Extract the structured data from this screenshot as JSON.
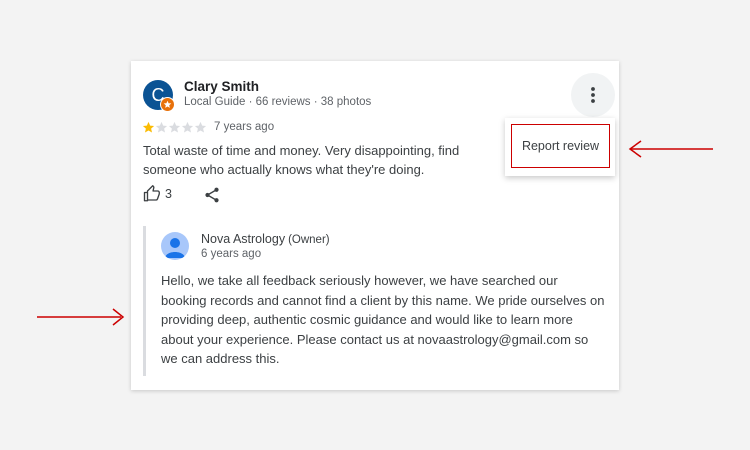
{
  "review": {
    "avatar_initial": "C",
    "author": "Clary Smith",
    "author_meta": "Local Guide · 66 reviews · 38 photos",
    "rating": 1,
    "rating_max": 5,
    "age": "7 years ago",
    "text": "Total waste of time and money. Very disappointing, find someone who actually knows what they're doing.",
    "like_count": "3"
  },
  "owner_reply": {
    "name": "Nova Astrology",
    "tag": "(Owner)",
    "age": "6 years ago",
    "text": "Hello, we take all feedback seriously however, we have searched our booking records and cannot find a client by this name. We pride ourselves on providing deep, authentic cosmic guidance and would like to learn more about your experience. Please contact us at novaastrology@gmail.com so we can address this."
  },
  "menu": {
    "report_label": "Report review"
  },
  "colors": {
    "avatar": "#0b5394",
    "badge": "#e8710a",
    "star_filled": "#fbbc04",
    "star_empty": "#dadce0",
    "annotation": "#cc0000"
  },
  "icons": [
    "more-vert-icon",
    "thumb-up-icon",
    "share-icon",
    "local-guide-badge-icon",
    "person-icon",
    "star-icon",
    "arrow-right-icon",
    "arrow-left-icon"
  ]
}
